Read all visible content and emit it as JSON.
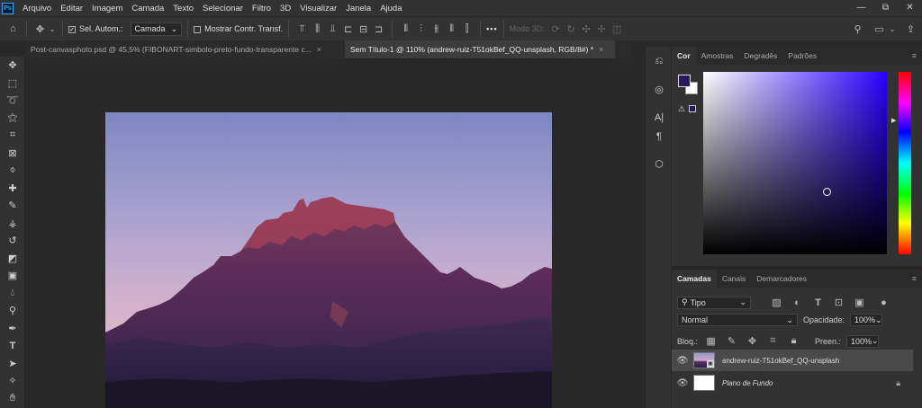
{
  "menubar": {
    "logo": "Ps",
    "items": [
      "Arquivo",
      "Editar",
      "Imagem",
      "Camada",
      "Texto",
      "Selecionar",
      "Filtro",
      "3D",
      "Visualizar",
      "Janela",
      "Ajuda"
    ],
    "window_buttons": [
      "—",
      "⧉",
      "✕"
    ]
  },
  "options": {
    "auto_select_label": "Sel. Autom.:",
    "auto_select_value": "Camada",
    "transform_label": "Mostrar Contr. Transf.",
    "mode_3d_label": "Modo 3D:",
    "more": "•••"
  },
  "tabs": [
    {
      "label": "Post-canvasphoto.psd @ 45,5% (FIBONART-simbolo-preto-fundo-transparente c...",
      "close": "×"
    },
    {
      "label": "Sem Título-1 @ 110% (andrew-ruiz-T51okBef_QQ-unsplash, RGB/8#) *",
      "close": "×"
    }
  ],
  "tools": [
    "move-tool",
    "marquee-tool",
    "lasso-tool",
    "magic-wand-tool",
    "crop-tool",
    "frame-tool",
    "eyedropper-tool",
    "healing-tool",
    "brush-tool",
    "stamp-tool",
    "history-brush-tool",
    "eraser-tool",
    "gradient-tool",
    "blur-tool",
    "dodge-tool",
    "pen-tool",
    "type-tool",
    "path-select-tool",
    "shape-tool",
    "hand-tool"
  ],
  "color_panel": {
    "tabs": [
      "Cor",
      "Amostras",
      "Degradês",
      "Padrões"
    ],
    "menu": "≡",
    "fg_color": "#2a1a5a",
    "bg_color": "#ffffff"
  },
  "layers_panel": {
    "tabs": [
      "Camadas",
      "Canais",
      "Demarcadores"
    ],
    "menu": "≡",
    "filter_value": "Tipo",
    "blend_mode": "Normal",
    "opacity_label": "Opacidade:",
    "opacity_value": "100%",
    "lock_label": "Bloq.:",
    "fill_label": "Preen.:",
    "fill_value": "100%",
    "layers": [
      {
        "name": "andrew-ruiz-T51okBef_QQ-unsplash"
      },
      {
        "name": "Plano de Fundo"
      }
    ]
  }
}
